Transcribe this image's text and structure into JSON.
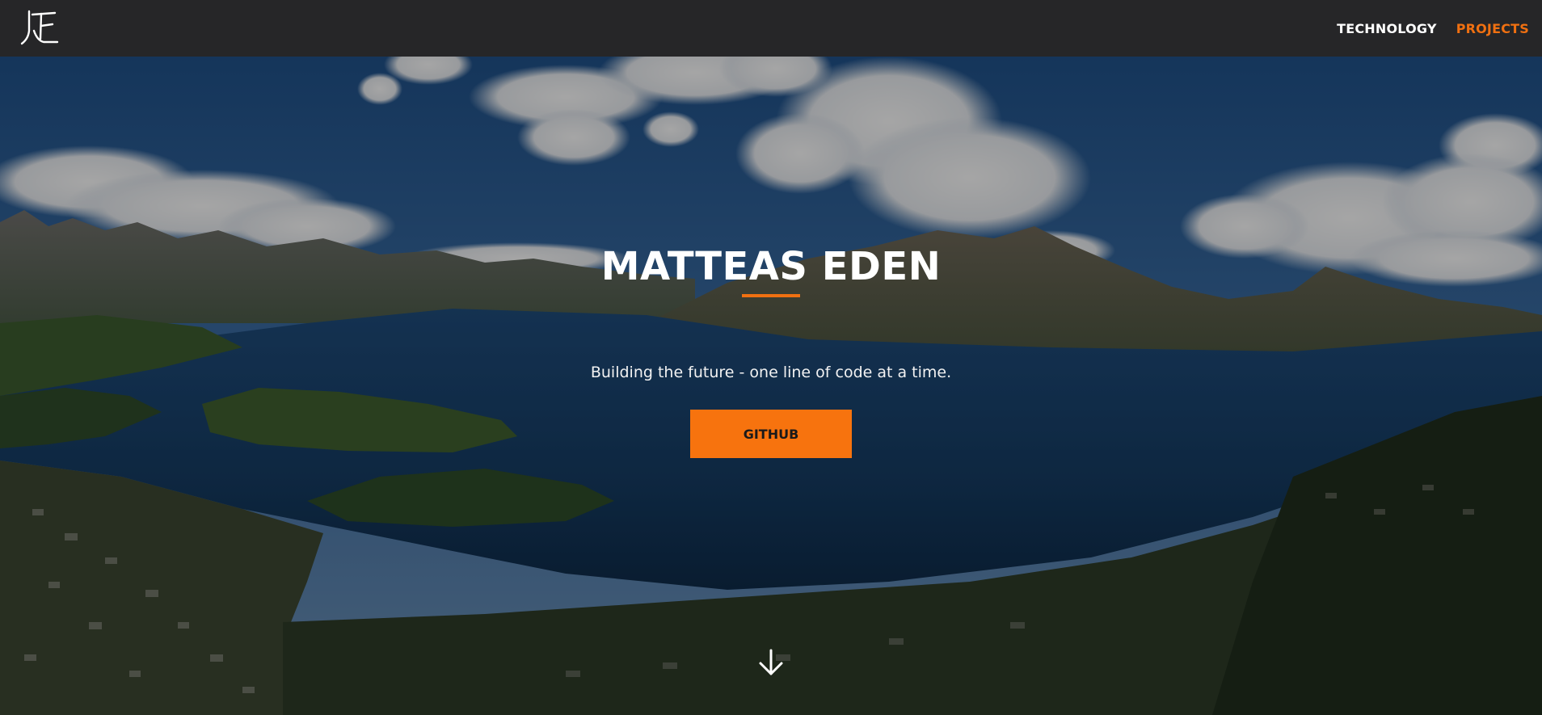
{
  "navbar": {
    "logo_icon": "monogram-logo-icon",
    "links": [
      {
        "label": "TECHNOLOGY",
        "active": false
      },
      {
        "label": "PROJECTS",
        "active": true
      }
    ]
  },
  "hero": {
    "title": "MATTEAS EDEN",
    "subtitle": "Building the future - one line of code at a time.",
    "button_label": "GITHUB",
    "background": "lake-and-mountains-landscape",
    "scroll_icon": "arrow-down-icon"
  },
  "colors": {
    "accent": "#f07011",
    "navbar": "#262628",
    "text": "#ffffff"
  }
}
